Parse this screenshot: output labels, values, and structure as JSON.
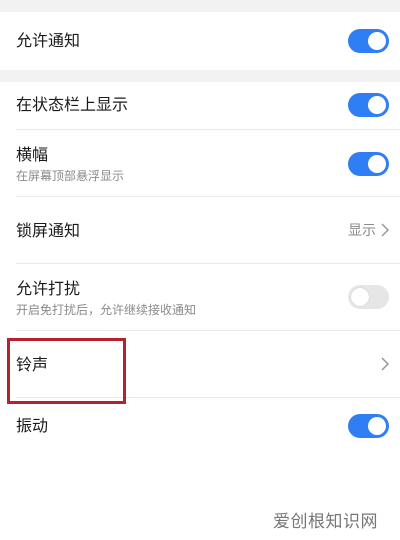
{
  "settings": [
    {
      "label": "允许通知",
      "type": "toggle",
      "state": "on"
    },
    {
      "label": "在状态栏上显示",
      "type": "toggle",
      "state": "on"
    },
    {
      "label": "横幅",
      "subtitle": "在屏幕顶部悬浮显示",
      "type": "toggle",
      "state": "on"
    },
    {
      "label": "锁屏通知",
      "value": "显示",
      "type": "link"
    },
    {
      "label": "允许打扰",
      "subtitle": "开启免打扰后，允许继续接收通知",
      "type": "toggle",
      "state": "off"
    },
    {
      "label": "铃声",
      "type": "link"
    },
    {
      "label": "振动",
      "type": "toggle",
      "state": "on"
    }
  ],
  "colors": {
    "toggle_on": "#2f7ef3",
    "toggle_off": "#e6e6e6",
    "highlight_box": "#b5212c"
  },
  "watermark": "爱创根知识网"
}
